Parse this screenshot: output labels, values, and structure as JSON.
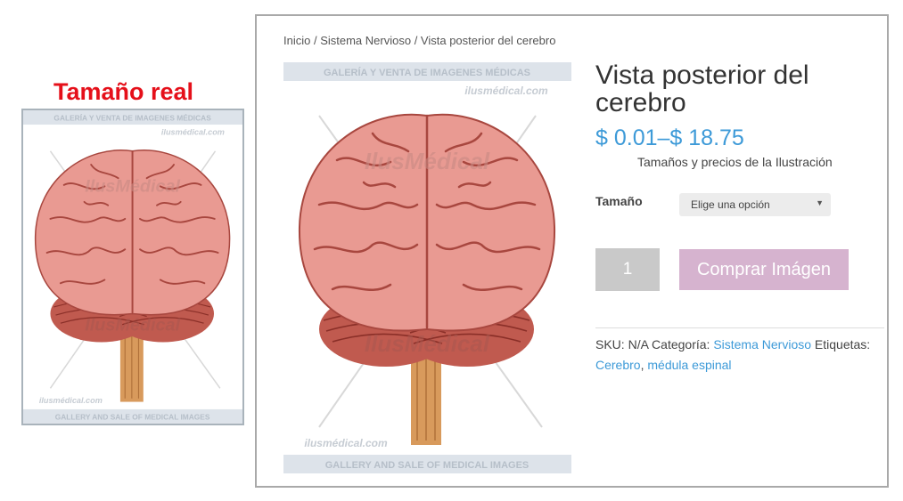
{
  "side": {
    "real_size_label": "Tamaño real"
  },
  "watermark": {
    "top_banner": "GALERÍA Y VENTA DE IMAGENES MÉDICAS",
    "site": "ilusmédical.com",
    "bottom_banner": "GALLERY AND SALE OF MEDICAL IMAGES",
    "center": "IlusMédical"
  },
  "breadcrumb": {
    "home": "Inicio",
    "sep1": " / ",
    "category": "Sistema Nervioso",
    "sep2": " / ",
    "current": "Vista posterior del cerebro"
  },
  "product": {
    "title": "Vista posterior del cerebro",
    "price": "$ 0.01–$ 18.75",
    "price_note": "Tamaños y precios de la Ilustración",
    "size_label": "Tamaño",
    "size_select": "Elige una opción",
    "quantity": "1",
    "buy_label": "Comprar Imágen"
  },
  "meta": {
    "sku_label": "SKU: ",
    "sku_value": "N/A",
    "category_label": " Categoría: ",
    "category": "Sistema Nervioso",
    "tags_label": " Etiquetas: ",
    "tag1": "Cerebro",
    "tag_sep": ", ",
    "tag2": "médula espinal"
  },
  "colors": {
    "accent": "#3d9ad8",
    "buy": "#d6b3cf",
    "red_label": "#e5101a"
  }
}
